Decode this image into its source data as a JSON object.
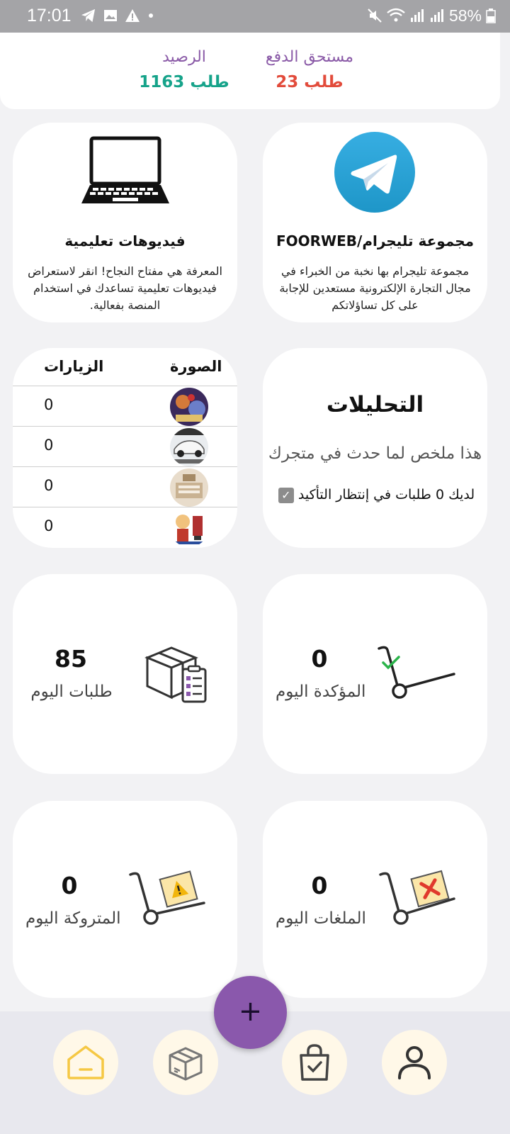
{
  "status_bar": {
    "time": "17:01",
    "battery": "58%"
  },
  "balance": {
    "due_label": "مستحق الدفع",
    "due_value": "23 طلب",
    "balance_label": "الرصيد",
    "balance_value": "1163 طلب"
  },
  "telegram_card": {
    "title": "FOORWEB/مجموعة تليجرام",
    "description": "مجموعة تليجرام بها نخبة من الخبراء في مجال التجارة الإلكترونية مستعدين للإجابة على كل تساؤلاتكم"
  },
  "videos_card": {
    "title": "فيديوهات تعليمية",
    "description": "المعرفة هي مفتاح النجاح! انقر لاستعراض فيديوهات تعليمية تساعدك في استخدام المنصة بفعالية."
  },
  "analytics": {
    "title": "التحليلات",
    "subtitle": "هذا ملخص لما حدث في متجرك",
    "pending": "لديك 0 طلبات في إنتظار التأكيد",
    "pending_check": "✓"
  },
  "visits_table": {
    "col_image": "الصورة",
    "col_visits": "الزيارات",
    "rows": [
      {
        "visits": "0"
      },
      {
        "visits": "0"
      },
      {
        "visits": "0"
      },
      {
        "visits": "0"
      }
    ]
  },
  "stats": {
    "confirmed": {
      "value": "0",
      "label": "المؤكدة اليوم"
    },
    "orders": {
      "value": "85",
      "label": "طلبات اليوم"
    },
    "cancelled": {
      "value": "0",
      "label": "الملغات اليوم"
    },
    "abandoned": {
      "value": "0",
      "label": "المتروكة اليوم"
    }
  },
  "fab": {
    "label": "+"
  },
  "colors": {
    "accent_purple": "#8a58ac",
    "due_red": "#e24b3b",
    "balance_green": "#16a38a",
    "telegram_blue": "#2aa3e0"
  },
  "icons": [
    "telegram-icon",
    "laptop-icon",
    "cart-check-icon",
    "box-clipboard-icon",
    "cart-cancel-icon",
    "cart-warning-icon",
    "home-icon",
    "box-icon",
    "shopping-bag-icon",
    "user-icon"
  ]
}
